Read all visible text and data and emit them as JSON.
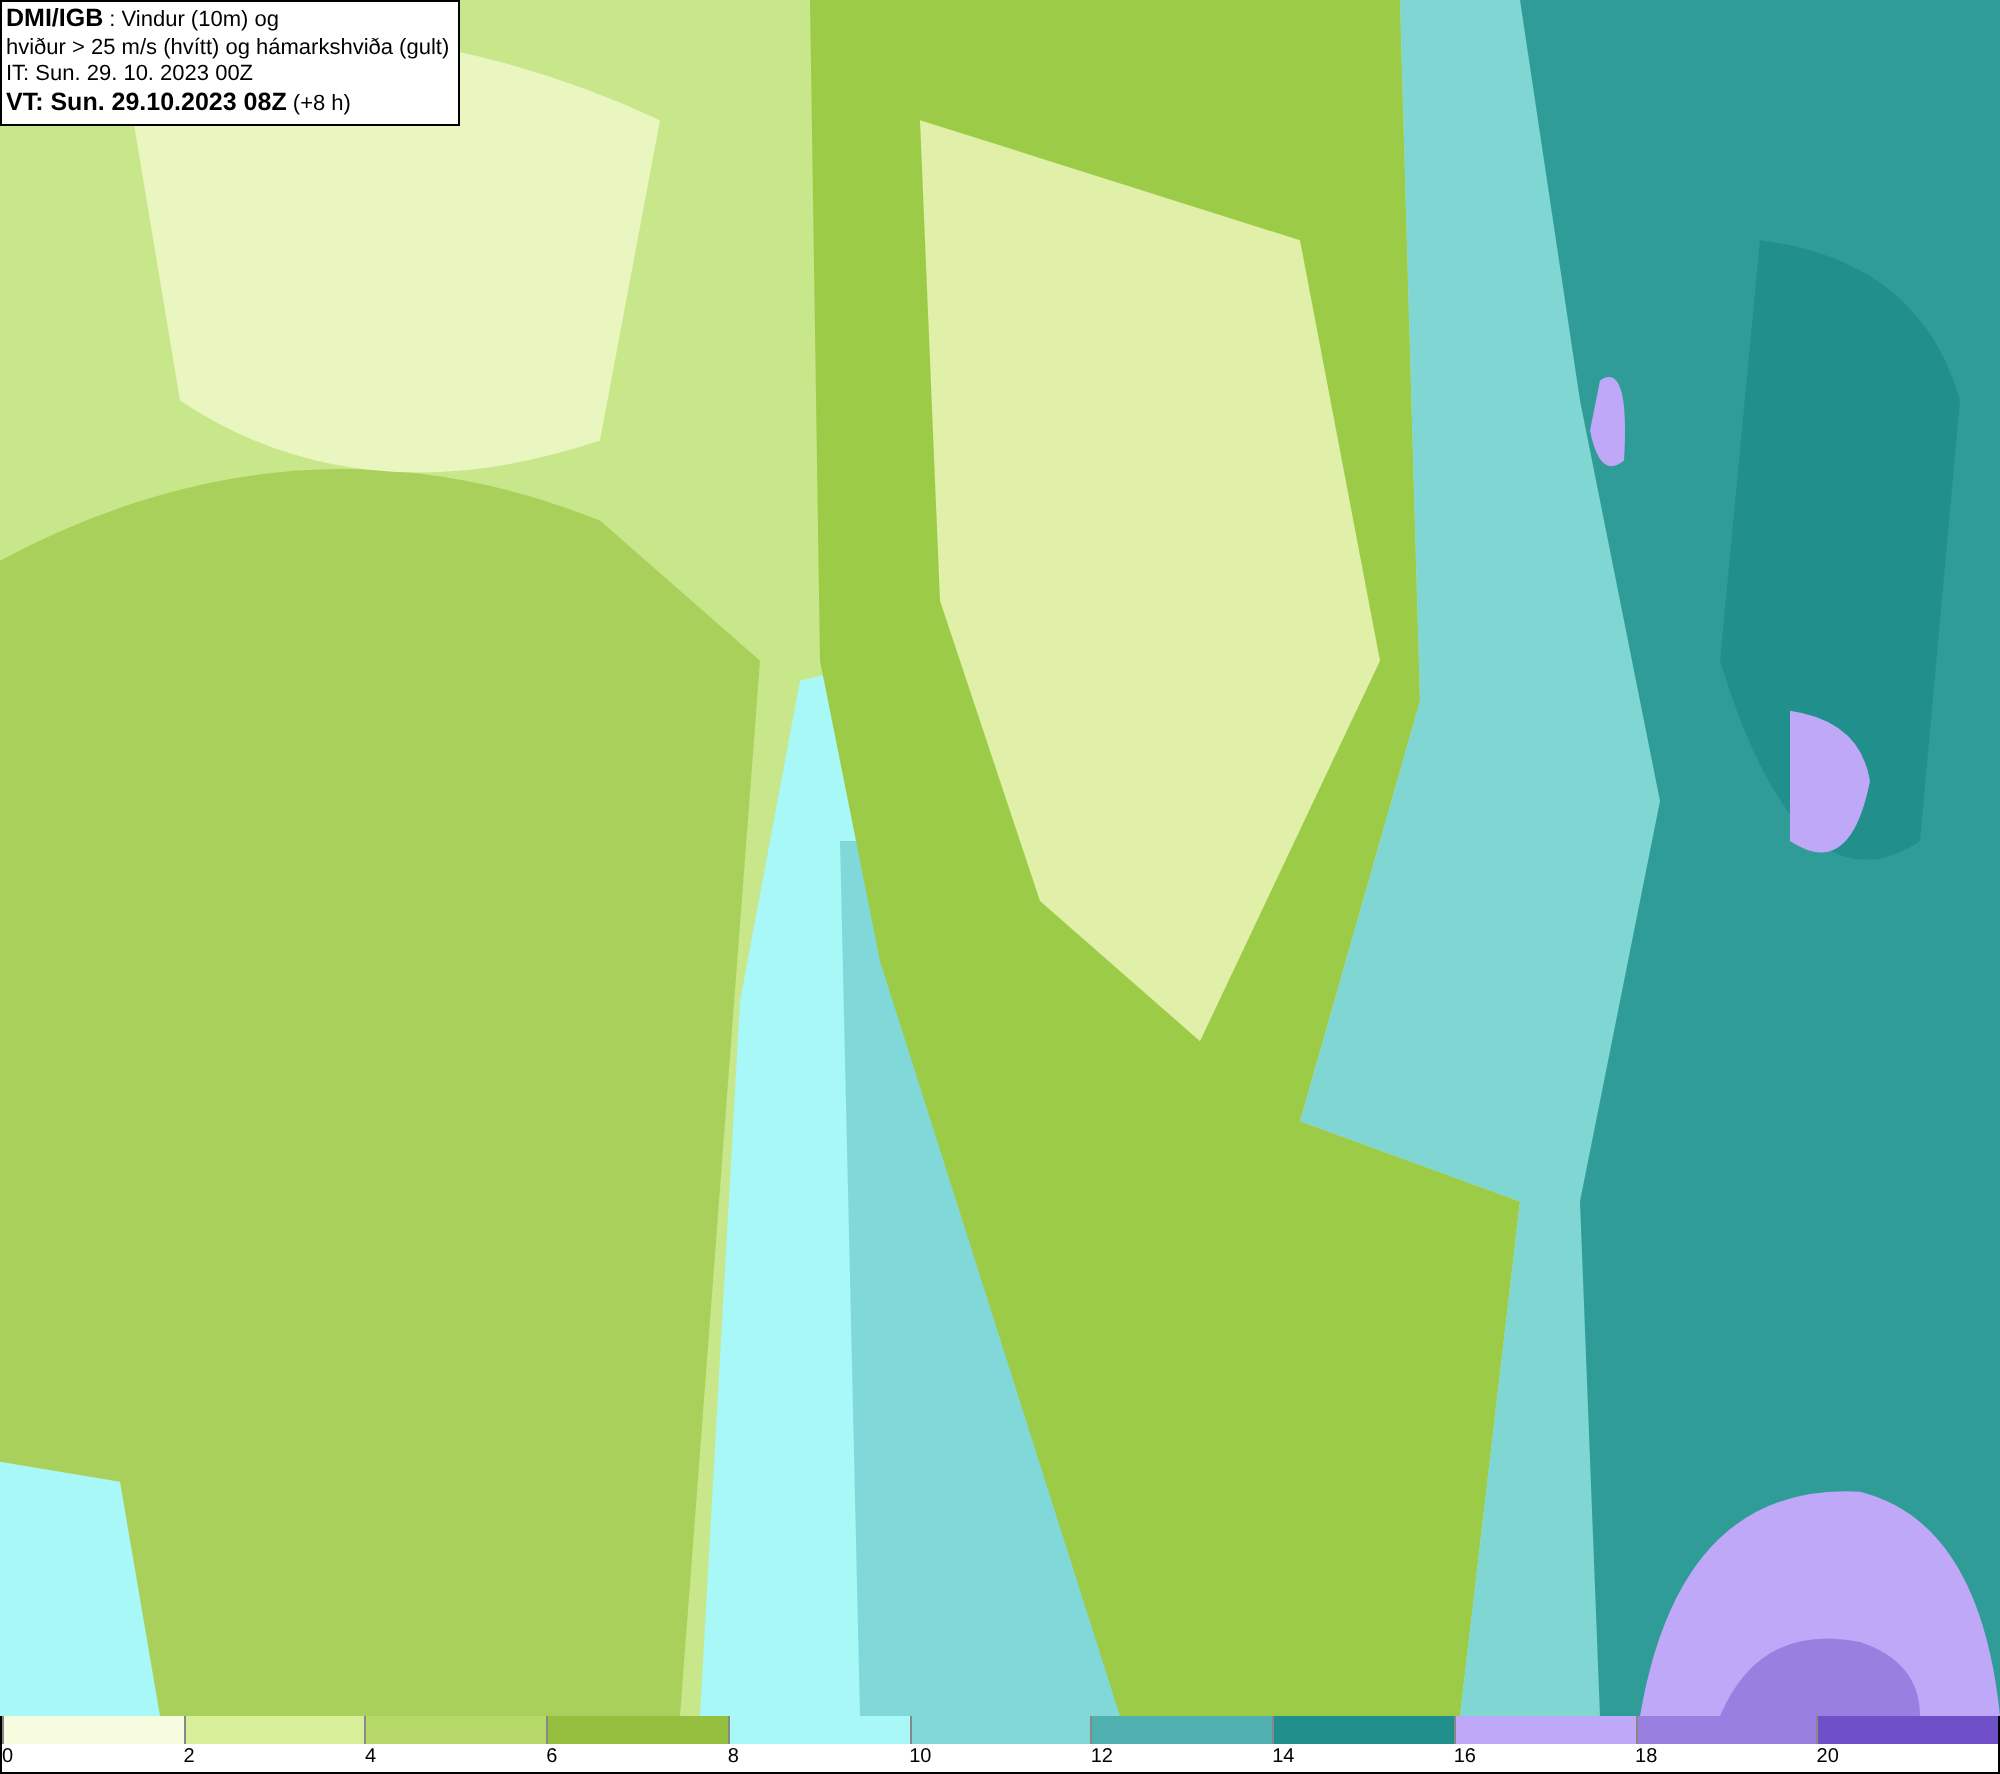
{
  "title_box": {
    "lines": [
      "**DMI/IGB** : Vindur (10m) og",
      "hviður > 25 m/s (hvítt) og hámarkshviða (gult)",
      "IT: Sun. 29. 10. 2023 00Z",
      "**VT: Sun. 29.10.2023 08Z** (+8 h)"
    ]
  },
  "legend": [
    {
      "label": "0",
      "color": "#f7fbe0"
    },
    {
      "label": "2",
      "color": "#d8ef9a"
    },
    {
      "label": "4",
      "color": "#b7d96a"
    },
    {
      "label": "6",
      "color": "#95bf3f"
    },
    {
      "label": "8",
      "color": "#a8f8f8"
    },
    {
      "label": "10",
      "color": "#80d8d8"
    },
    {
      "label": "12",
      "color": "#50b0b0"
    },
    {
      "label": "14",
      "color": "#218f8c"
    },
    {
      "label": "16",
      "color": "#c0a8f8"
    },
    {
      "label": "18",
      "color": "#9880e0"
    },
    {
      "label": "20",
      "color": "#7050c8"
    }
  ]
}
